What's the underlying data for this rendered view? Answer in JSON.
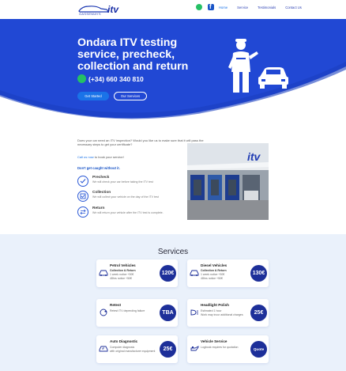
{
  "header": {
    "brand_small": "GASSEWAYS",
    "brand_itv": "itv",
    "nav": [
      {
        "label": "Home",
        "active": true
      },
      {
        "label": "Service",
        "active": false
      },
      {
        "label": "Testimonials",
        "active": false
      },
      {
        "label": "Contact Us",
        "active": false
      }
    ]
  },
  "hero": {
    "title": "Ondara ITV testing service, precheck, collection and return",
    "phone": "(+34) 660 340 810",
    "primary_button": "Get Started",
    "secondary_button": "Our Services"
  },
  "intro": {
    "text": "Does your car need an ITV inspection? Would you like us to make sure that it will pass the necessary steps to get your certificate?",
    "call_link": "Call us now",
    "call_rest": " to book your service!",
    "caught": "Don't get caught without it.",
    "features": [
      {
        "title": "Precheck",
        "desc": "We will check your car before taking the ITV test",
        "icon": "check-icon"
      },
      {
        "title": "Collection",
        "desc": "We will collect your vehicle on the day of the ITV test",
        "icon": "checkbox-icon"
      },
      {
        "title": "Return",
        "desc": "We will return your vehicle after the ITV test is complete.",
        "icon": "swap-arrows-icon"
      }
    ]
  },
  "services": {
    "title": "Services",
    "cards": [
      {
        "title": "Petrol Vehicles",
        "lines": [
          "Collection & Return",
          "1 week notice +30€",
          "48hrs notice +50€"
        ],
        "price": "120€",
        "icon": "car-icon"
      },
      {
        "title": "Diesel Vehicles",
        "lines": [
          "Collection & Return",
          "1 week notice +30€",
          "48hrs notice +50€"
        ],
        "price": "130€",
        "icon": "car-icon"
      },
      {
        "title": "Retest",
        "lines": [
          "Retest ITV depending failure"
        ],
        "price": "TBA",
        "icon": "refresh-icon"
      },
      {
        "title": "Headlight Polish",
        "lines": [
          "Estimated 1 hour",
          "Work may incur additional charges"
        ],
        "price": "25€",
        "icon": "headlight-icon"
      },
      {
        "title": "Auto Diagnostic",
        "lines": [
          "Computer diagnosis",
          "with original manufacturer equipment"
        ],
        "price": "25€",
        "icon": "car-diagnostic-icon"
      },
      {
        "title": "Vehicle Service",
        "lines": [
          "Logbook requires for quotation"
        ],
        "price": "Quote",
        "icon": "oil-can-icon"
      }
    ]
  },
  "colors": {
    "hero": "#2148d4",
    "accent": "#1a73e8",
    "price_badge": "#1d2f99",
    "services_bg": "#eaf1fb"
  }
}
